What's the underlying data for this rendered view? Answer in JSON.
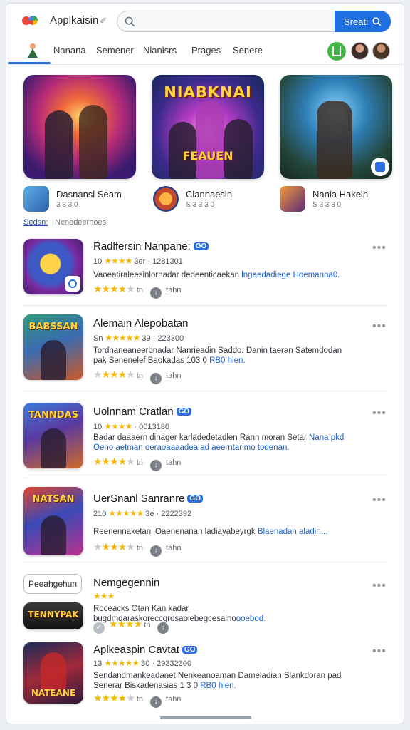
{
  "header": {
    "app_title": "Applkaisin",
    "pin_icon": "pin-icon",
    "search_placeholder": "",
    "search_button": "Sreati"
  },
  "nav": {
    "tabs": [
      "Nanana",
      "Semener",
      "Nlanisrs",
      "Prages",
      "Senere"
    ]
  },
  "featured": [
    {
      "name": "Dasnansl Seam",
      "sub": "3 3 3 0",
      "art_top": "",
      "art_bottom": ""
    },
    {
      "name": "Clannaesin",
      "sub": "S 3 3 3 0",
      "art_top": "NIABKNAI",
      "art_bottom": "FEAUEN"
    },
    {
      "name": "Nania Hakein",
      "sub": "S 3 3 3 0",
      "art_top": "",
      "art_bottom": ""
    }
  ],
  "see_all": {
    "link": "Sedsn:",
    "text": "Nenedeernoes"
  },
  "apps": [
    {
      "title": "Radlfersin Nanpane:",
      "tag": "GO",
      "sub_pre": "10",
      "stars": "★★★★",
      "sub_post": "3er · 1281301",
      "desc": "Vaoeatiraleesinlornadar dedeenticaekan",
      "desc_link": "lngaedadiege Hoemanna0.",
      "rating": 4,
      "foot_a": "tn",
      "foot_b": "tahn",
      "thumb_text": ""
    },
    {
      "title": "Alemain Alepobatan",
      "tag": "",
      "sub_pre": "Sn",
      "stars": "★★★★★",
      "sub_post": "39 · 223300",
      "desc": "Tordnaneaneerbnadar Nanrieadin Saddo: Danin taeran Satemdodan pak Senenelef Baokadas 103 0",
      "desc_link": "RB0 hlen.",
      "rating": 4,
      "foot_a": "tn",
      "foot_b": "tahn",
      "thumb_text": "BABSSAN"
    },
    {
      "title": "Uolnnam Cratlan",
      "tag": "GO",
      "sub_pre": "10",
      "stars": "★★★★",
      "sub_post": "· 0013180",
      "desc": "Badar daaaern dinager karladedetadlen Rann moran Setar",
      "desc_link": "Nana pkd Oeno aetman oeraoaaaadea ad aeerntarimo todenan.",
      "rating": 4,
      "foot_a": "tn",
      "foot_b": "tahn",
      "thumb_text": "TANNDAS"
    },
    {
      "title": "UerSnanl Sanranre",
      "tag": "GO",
      "sub_pre": "210",
      "stars": "★★★★★",
      "sub_post": "3e · 2222392",
      "desc": "Reenennaketani Oaenenanan ladiayabeyrgk",
      "desc_link": "Blaenadan aladin...",
      "rating": 4,
      "foot_a": "tn",
      "foot_b": "tahn",
      "thumb_text": "NATSAN"
    },
    {
      "title": "Nemgegennin",
      "tag": "",
      "sub_pre": "",
      "stars": "★★★",
      "sub_post": "",
      "desc": "Roceacks Otan Kan  kadar bugdmdaraskoreccgrosaoiebegcesalno",
      "desc_link": "ooebod.",
      "rating": 4,
      "foot_a": "tn",
      "foot_b": "",
      "thumb_text": "TENNYPAK",
      "chip": "Peeahgehun"
    },
    {
      "title": "Aplkeaspin Cavtat",
      "tag": "GO",
      "sub_pre": "13",
      "stars": "★★★★★",
      "sub_post": "30 · 29332300",
      "desc": "Sendandmankeadanet Nenkeanoaman Dameladian Slankdoran pad Senerar Biskadenasias 1 3 0",
      "desc_link": "RB0 hlen.",
      "rating": 4,
      "foot_a": "tn",
      "foot_b": "tahn",
      "thumb_text": "NATEANE"
    }
  ],
  "colors": {
    "accent": "#1f6fe0",
    "star": "#f2b706",
    "link": "#1d5fc9",
    "green": "#43b649"
  }
}
